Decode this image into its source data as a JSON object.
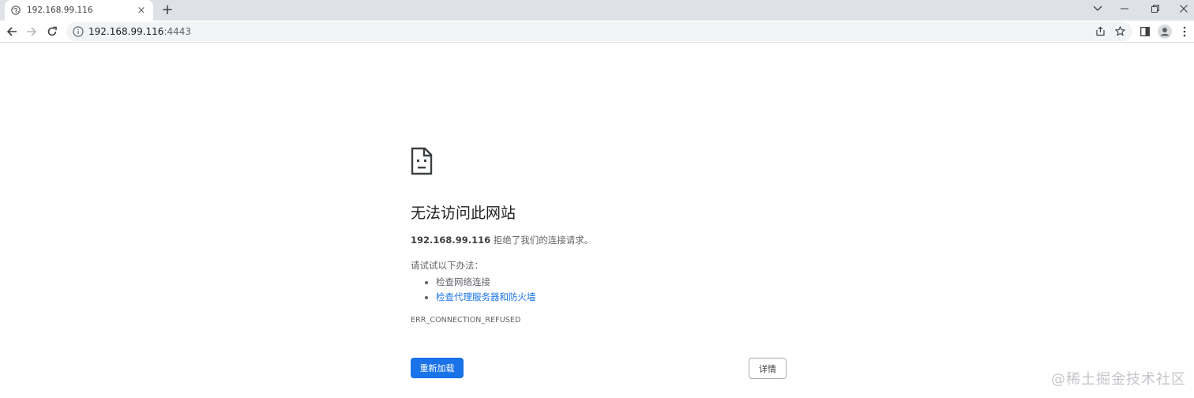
{
  "browser": {
    "tab": {
      "title": "192.168.99.116",
      "favicon": "globe-icon",
      "close": "×"
    },
    "new_tab": "+",
    "address": {
      "host": "192.168.99.116",
      "port": ":4443"
    },
    "colors": {
      "accent": "#1a73e8",
      "tabstrip": "#dee1e6",
      "omnibox": "#f1f3f4"
    }
  },
  "error_page": {
    "icon": "sad-page-icon",
    "heading": "无法访问此网站",
    "host": "192.168.99.116",
    "summary_rest": " 拒绝了我们的连接请求。",
    "try_label": "请试试以下办法：",
    "suggestions": [
      {
        "text": "检查网络连接",
        "link": false
      },
      {
        "text": "检查代理服务器和防火墙",
        "link": true
      }
    ],
    "error_code": "ERR_CONNECTION_REFUSED",
    "reload_label": "重新加载",
    "details_label": "详情"
  },
  "watermark": "@稀土掘金技术社区"
}
